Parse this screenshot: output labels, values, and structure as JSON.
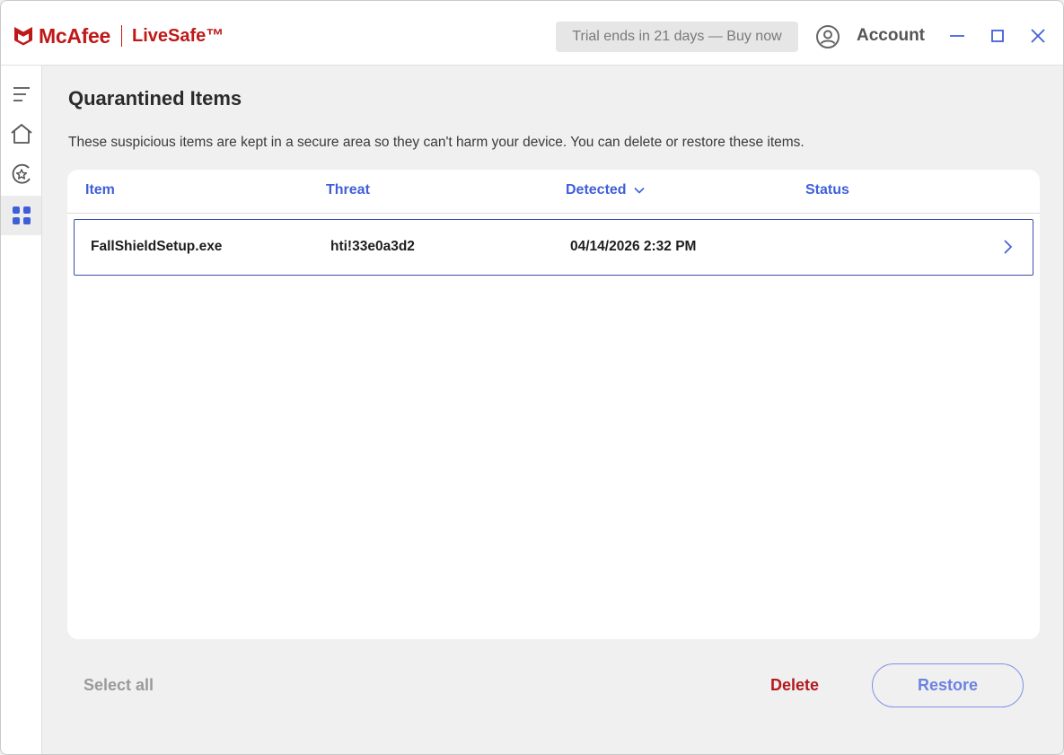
{
  "app": {
    "brand_name": "McAfee",
    "product_name": "LiveSafe™",
    "trial_text": "Trial ends in 21 days — Buy now",
    "account_label": "Account",
    "brand_color": "#c01818"
  },
  "window_controls": [
    "minimize-icon",
    "maximize-icon",
    "close-icon"
  ],
  "sidebar": {
    "items": [
      {
        "icon": "menu-icon",
        "active": false
      },
      {
        "icon": "home-icon",
        "active": false
      },
      {
        "icon": "protection-icon",
        "active": false
      },
      {
        "icon": "apps-grid-icon",
        "active": true
      }
    ]
  },
  "page": {
    "title": "Quarantined Items",
    "description": "These suspicious items are kept in a secure area so they can't harm your device. You can delete or restore these items."
  },
  "table": {
    "columns": {
      "item": "Item",
      "threat": "Threat",
      "detected": "Detected",
      "status": "Status"
    },
    "sort_column": "Detected",
    "rows": [
      {
        "item": "FallShieldSetup.exe",
        "threat": "hti!33e0a3d2",
        "detected": "04/14/2026 2:32 PM",
        "status": ""
      }
    ]
  },
  "actions": {
    "select_all": "Select all",
    "delete": "Delete",
    "restore": "Restore"
  },
  "colors": {
    "accent_blue": "#3f5fd8",
    "delete_red": "#b3191d",
    "restore_outline": "#7d92e8"
  }
}
